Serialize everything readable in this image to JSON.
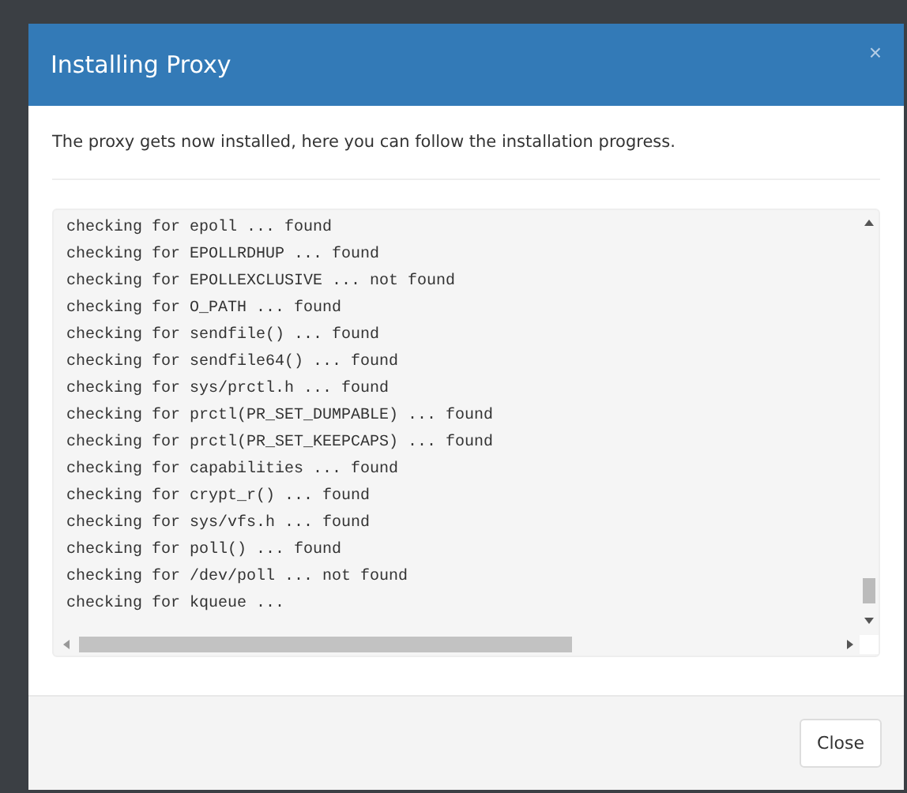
{
  "dialog": {
    "title": "Installing Proxy",
    "close_icon": "×",
    "intro": "The proxy gets now installed, here you can follow the installation progress.",
    "log_lines": [
      "checking for epoll ... found",
      "checking for EPOLLRDHUP ... found",
      "checking for EPOLLEXCLUSIVE ... not found",
      "checking for O_PATH ... found",
      "checking for sendfile() ... found",
      "checking for sendfile64() ... found",
      "checking for sys/prctl.h ... found",
      "checking for prctl(PR_SET_DUMPABLE) ... found",
      "checking for prctl(PR_SET_KEEPCAPS) ... found",
      "checking for capabilities ... found",
      "checking for crypt_r() ... found",
      "checking for sys/vfs.h ... found",
      "checking for poll() ... found",
      "checking for /dev/poll ... not found",
      "checking for kqueue ..."
    ],
    "buttons": [
      "Close"
    ]
  }
}
